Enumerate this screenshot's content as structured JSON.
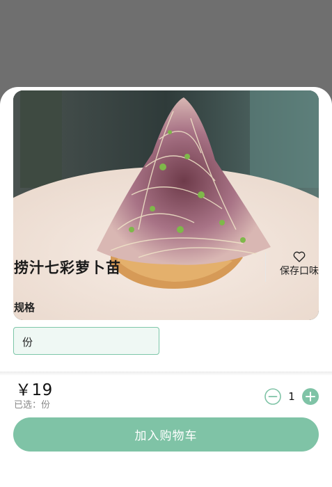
{
  "dish": {
    "title": "捞汁七彩萝卜苗",
    "photo_icon": "dish-photo"
  },
  "save": {
    "label": "保存口味",
    "icon": "heart-outline-icon"
  },
  "spec": {
    "heading": "规格",
    "options": [
      {
        "label": "份",
        "selected": true
      }
    ]
  },
  "footer": {
    "price": "￥19",
    "selected_text": "已选：份",
    "quantity": "1",
    "add_to_cart_label": "加入购物车"
  },
  "colors": {
    "accent": "#7fc3a6",
    "accent_border": "#7cc6a8",
    "accent_bg": "#eff8f4"
  }
}
